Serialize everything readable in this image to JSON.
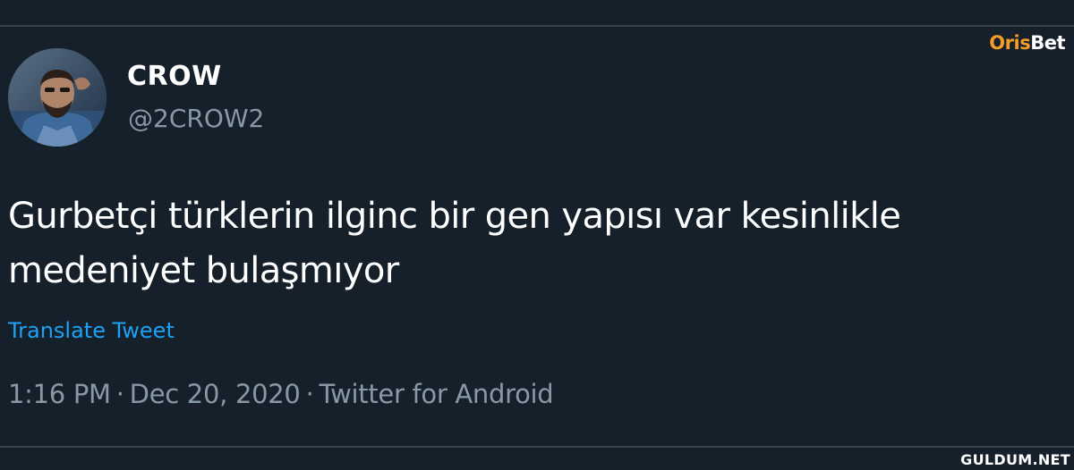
{
  "watermark": {
    "part1": "Oris",
    "part2": "Bet",
    "colors": {
      "part1": "#f39c2a",
      "part2": "#ffffff"
    }
  },
  "tweet": {
    "author": {
      "display_name": "CROW",
      "handle": "@2CROW2",
      "avatar_icon": "profile-photo"
    },
    "text": "Gurbetçi türklerin ilginc bir gen yapısı var kesinlikle\nmedeniyet bulaşmıyor",
    "translate_label": "Translate Tweet",
    "time": "1:16 PM",
    "date": "Dec 20, 2020",
    "separator": "·",
    "source": "Twitter for Android"
  },
  "site_watermark": "GULDUM.NET",
  "colors": {
    "background": "#15202b",
    "divider": "#38444d",
    "primary_text": "#ffffff",
    "secondary_text": "#8899a6",
    "link": "#1da1f2"
  }
}
